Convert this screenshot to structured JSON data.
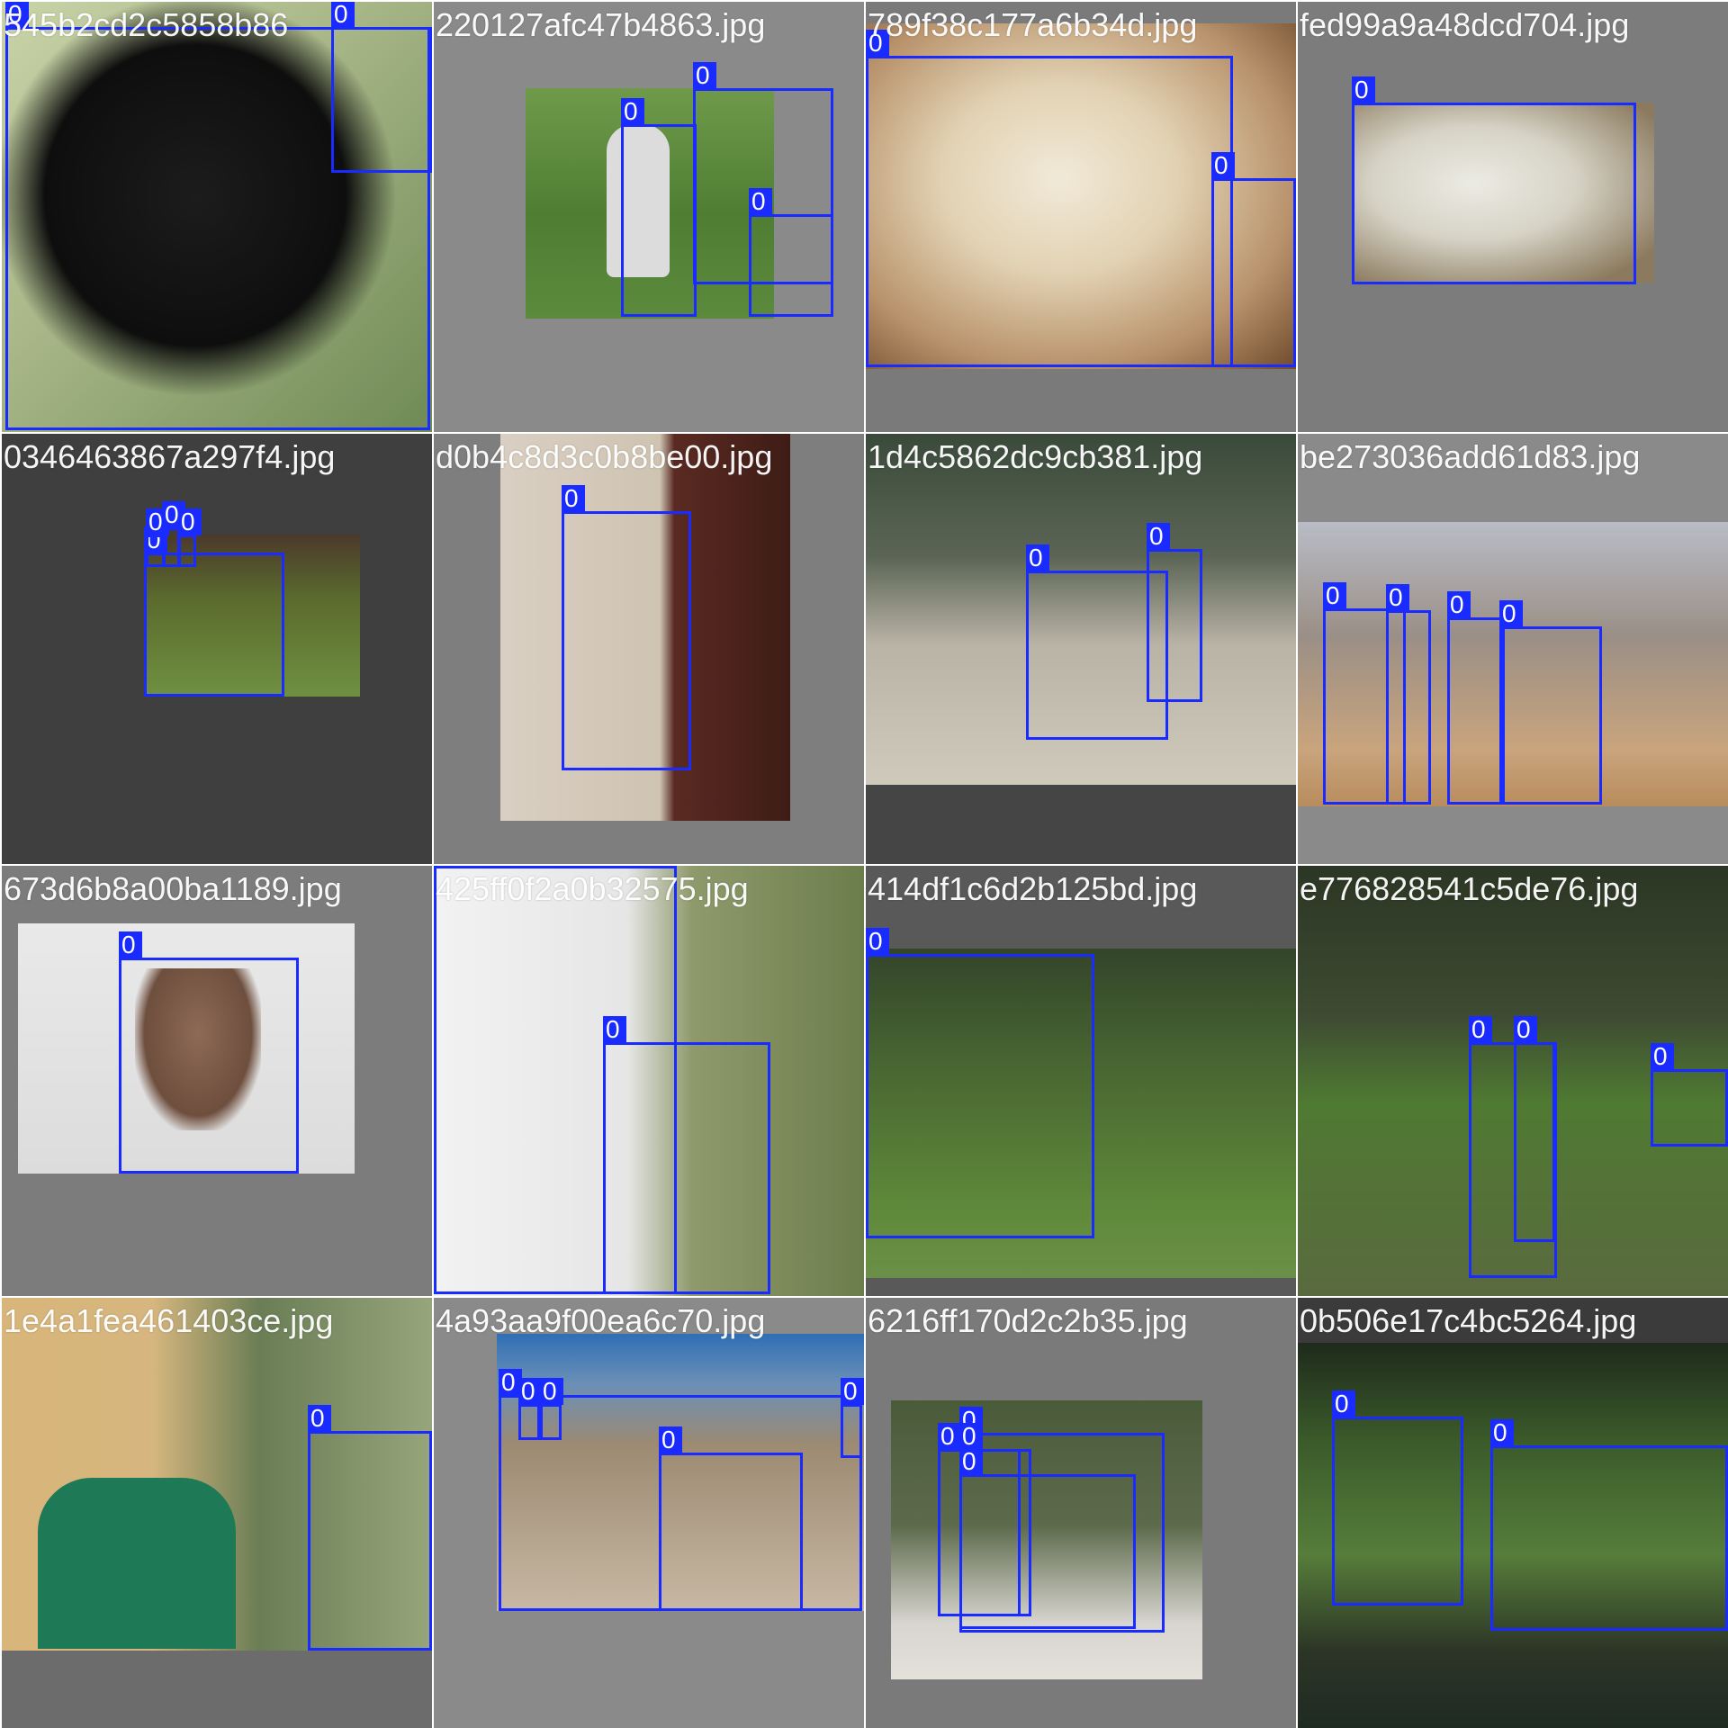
{
  "tiles": [
    {
      "caption": "545b2cd2c5858b86",
      "boxes": [
        "0",
        "0"
      ]
    },
    {
      "caption": "220127afc47b4863.jpg",
      "boxes": [
        "0",
        "0",
        "0"
      ]
    },
    {
      "caption": "789f38c177a6b34d.jpg",
      "boxes": [
        "0",
        "0"
      ]
    },
    {
      "caption": "fed99a9a48dcd704.jpg",
      "boxes": [
        "0"
      ]
    },
    {
      "caption": "0346463867a297f4.jpg",
      "boxes": [
        "0",
        "0",
        "0",
        "0"
      ]
    },
    {
      "caption": "d0b4c8d3c0b8be00.jpg",
      "boxes": [
        "0"
      ]
    },
    {
      "caption": "1d4c5862dc9cb381.jpg",
      "boxes": [
        "0",
        "0"
      ]
    },
    {
      "caption": "be273036add61d83.jpg",
      "boxes": [
        "0",
        "0",
        "0",
        "0"
      ]
    },
    {
      "caption": "673d6b8a00ba1189.jpg",
      "boxes": [
        "0"
      ]
    },
    {
      "caption": "425ff0f2a0b32575.jpg",
      "boxes": [
        "0",
        "0"
      ]
    },
    {
      "caption": "414df1c6d2b125bd.jpg",
      "boxes": [
        "0"
      ]
    },
    {
      "caption": "e776828541c5de76.jpg",
      "boxes": [
        "0",
        "0",
        "0"
      ]
    },
    {
      "caption": "1e4a1fea461403ce.jpg",
      "boxes": [
        "0"
      ]
    },
    {
      "caption": "4a93aa9f00ea6c70.jpg",
      "boxes": [
        "0",
        "0",
        "0",
        "0",
        "0"
      ]
    },
    {
      "caption": "6216ff170d2c2b35.jpg",
      "boxes": [
        "0",
        "0",
        "0",
        "0"
      ]
    },
    {
      "caption": "0b506e17c4bc5264.jpg",
      "boxes": [
        "0",
        "0"
      ]
    }
  ],
  "box_color": "#1a2bff"
}
